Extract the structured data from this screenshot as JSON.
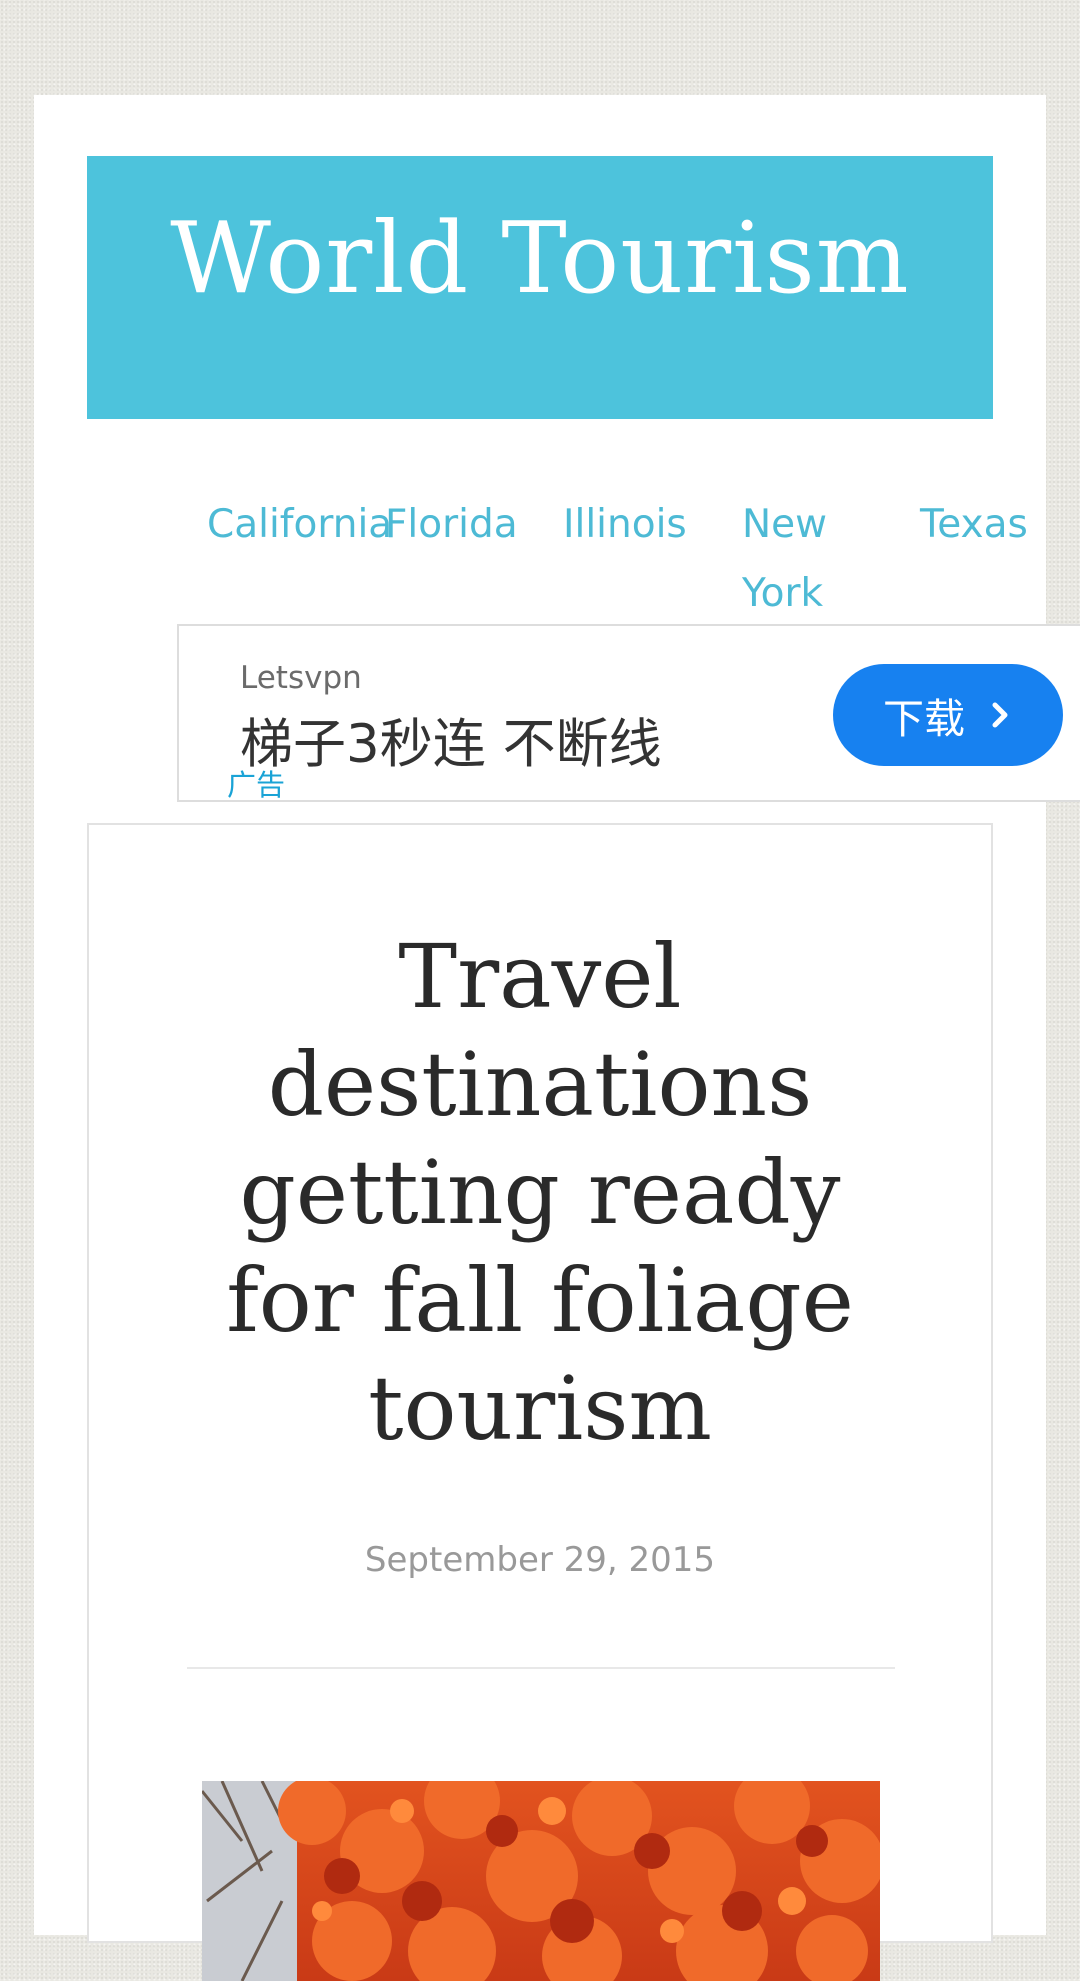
{
  "site": {
    "title": "World Tourism"
  },
  "nav": {
    "items": [
      {
        "label": "California"
      },
      {
        "label": "Florida"
      },
      {
        "label": "Illinois"
      },
      {
        "label": "New York"
      },
      {
        "label": "Texas"
      }
    ],
    "link_color": "#4dbad5"
  },
  "ad": {
    "advertiser": "Letsvpn",
    "headline": "梯子3秒连 不断线",
    "label": "广告",
    "button_label": "下载",
    "button_icon": "chevron-right-icon",
    "button_color": "#1781f0"
  },
  "article": {
    "title": "Travel destinations getting ready for fall foliage tourism",
    "date": "September 29, 2015",
    "image_icon": "autumn-tree-photo"
  },
  "colors": {
    "banner": "#4dc3dc",
    "page_background": "#e9e8e2"
  }
}
